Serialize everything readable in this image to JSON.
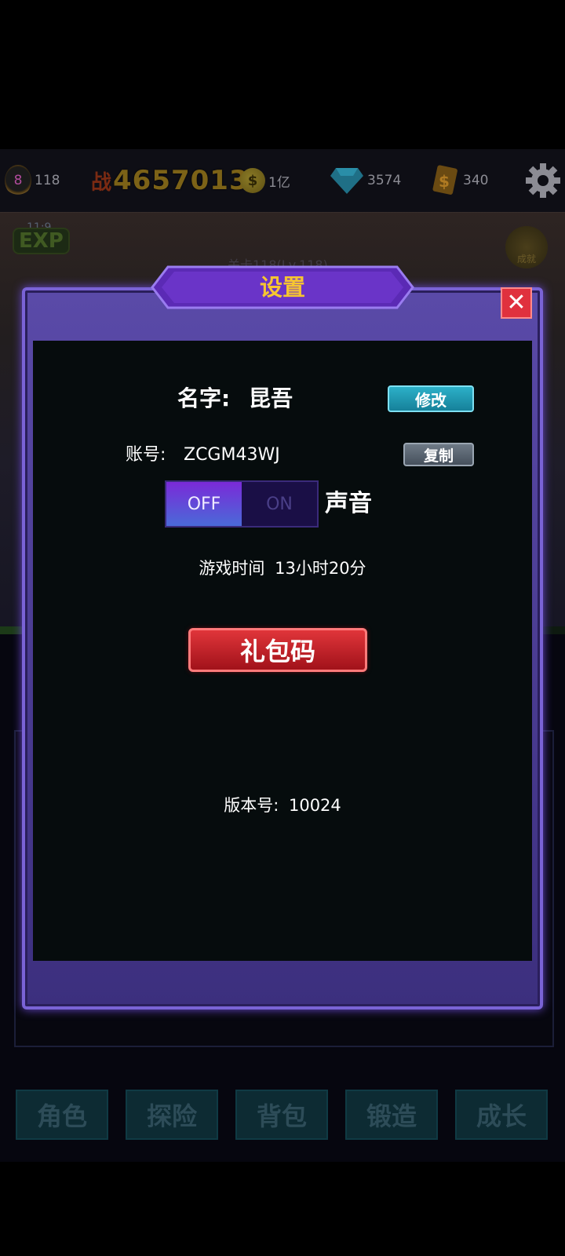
{
  "topbar": {
    "level": "8",
    "level_count": "118",
    "power": "4657013",
    "gold": "1亿",
    "diamonds": "3574",
    "tickets": "340"
  },
  "scene": {
    "exp_label": "EXP",
    "exp_timer": "11:9",
    "stage": "关卡118(Lv.118)",
    "achievement_label": "成就"
  },
  "modal": {
    "title": "设置",
    "close": "✕",
    "name_label": "名字:",
    "name_value": "昆吾",
    "edit_button": "修改",
    "account_label": "账号:",
    "account_value": "ZCGM43WJ",
    "copy_button": "复制",
    "sound_off": "OFF",
    "sound_on": "ON",
    "sound_label": "声音",
    "sound_state": "off",
    "playtime_label": "游戏时间",
    "playtime_value": "13小时20分",
    "gift_code_button": "礼包码",
    "version_label": "版本号:",
    "version_value": "10024"
  },
  "bottom_nav": {
    "items": [
      "角色",
      "探险",
      "背包",
      "锻造",
      "成长"
    ]
  },
  "colors": {
    "title_gold": "#f6c531",
    "edit_teal": "#2cb0c8",
    "gift_red": "#e0353a",
    "frame_purple": "#5a4aa8"
  }
}
